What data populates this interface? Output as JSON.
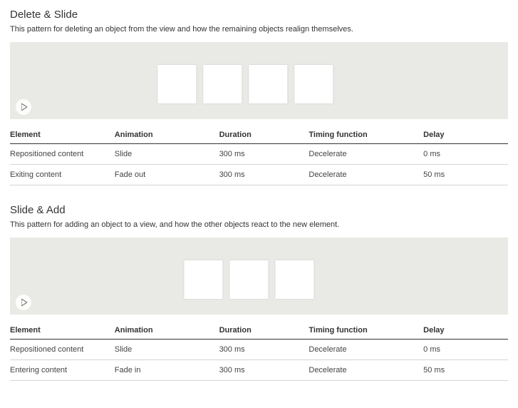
{
  "sections": [
    {
      "title": "Delete & Slide",
      "desc": "This pattern for deleting an object from the view and how the remaining objects realign themselves.",
      "card_count": 4,
      "table": {
        "headers": [
          "Element",
          "Animation",
          "Duration",
          "Timing function",
          "Delay"
        ],
        "rows": [
          [
            "Repositioned content",
            "Slide",
            "300 ms",
            "Decelerate",
            "0 ms"
          ],
          [
            "Exiting content",
            "Fade out",
            "300 ms",
            "Decelerate",
            "50 ms"
          ]
        ]
      }
    },
    {
      "title": "Slide & Add",
      "desc": "This pattern for adding an object to a view, and how the other objects react to the new element.",
      "card_count": 3,
      "table": {
        "headers": [
          "Element",
          "Animation",
          "Duration",
          "Timing function",
          "Delay"
        ],
        "rows": [
          [
            "Repositioned content",
            "Slide",
            "300 ms",
            "Decelerate",
            "0 ms"
          ],
          [
            "Entering content",
            "Fade in",
            "300 ms",
            "Decelerate",
            "50 ms"
          ]
        ]
      }
    }
  ]
}
